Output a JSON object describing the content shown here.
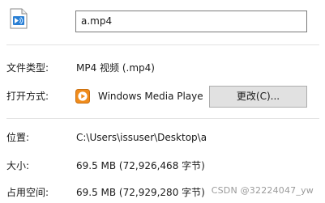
{
  "file": {
    "icon": "video-file-icon",
    "name": "a.mp4"
  },
  "properties": {
    "type_label": "文件类型:",
    "type_value": "MP4 视频 (.mp4)",
    "opens_with_label": "打开方式:",
    "opens_with_icon": "windows-media-player-icon",
    "opens_with_app": "Windows Media Playe",
    "change_button": "更改(C)...",
    "location_label": "位置:",
    "location_value": "C:\\Users\\issuser\\Desktop\\a",
    "size_label": "大小:",
    "size_value": "69.5 MB (72,926,468 字节)",
    "size_on_disk_label": "占用空间:",
    "size_on_disk_value": "69.5 MB (72,929,280 字节)"
  },
  "watermark": "CSDN @32224047_yw",
  "colors": {
    "wmp_orange": "#f08c1c",
    "file_icon_blue": "#2a7fd4",
    "button_face": "#e1e1e1"
  }
}
